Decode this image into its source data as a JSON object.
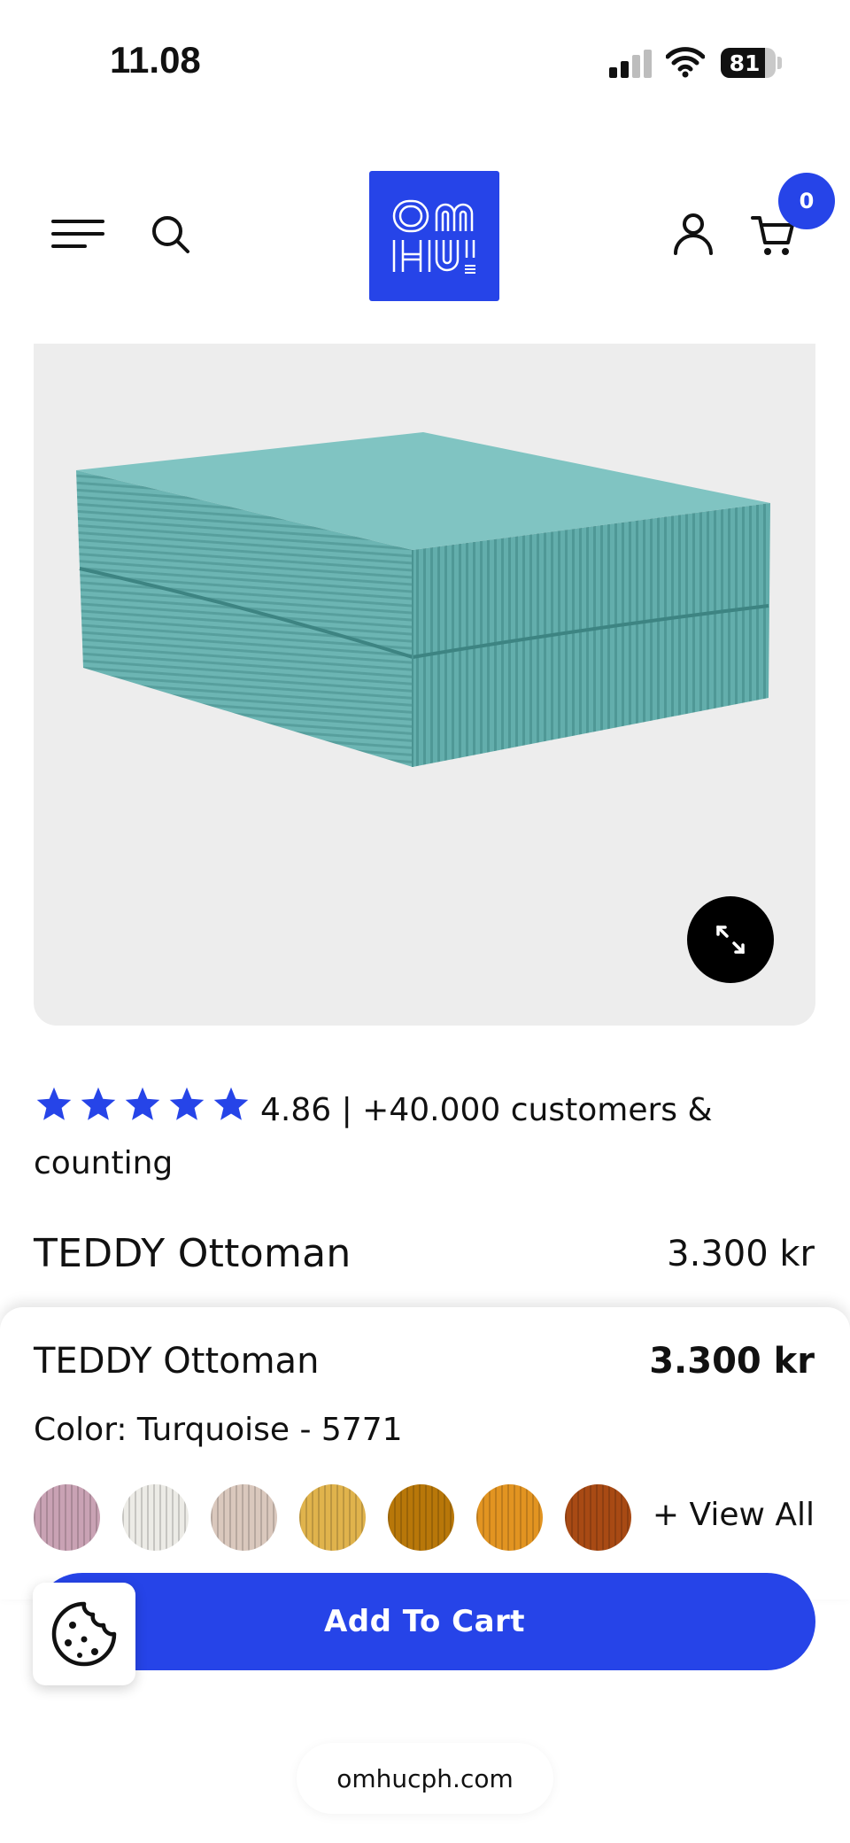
{
  "status_bar": {
    "time": "11.08",
    "battery": "81",
    "battery_level": 0.81
  },
  "header": {
    "logo_text": "OM HU",
    "cart_count": "0",
    "icons": [
      "hamburger-icon",
      "search-icon",
      "user-icon",
      "cart-icon"
    ]
  },
  "product_image": {
    "expand_icon": "expand-icon"
  },
  "rating": {
    "stars": 5,
    "text": "4.86 | +40.000 customers & counting"
  },
  "product": {
    "title": "TEDDY Ottoman",
    "price": "3.300 kr"
  },
  "sticky": {
    "title": "TEDDY Ottoman",
    "price": "3.300 kr",
    "color_label": "Color: Turquoise - 5771",
    "swatches": [
      "#c9a2b4",
      "#ecebe6",
      "#dac8bd",
      "#e0b34c",
      "#b87709",
      "#e29421",
      "#a84a14"
    ],
    "view_all": "+ View All",
    "add_to_cart": "Add To Cart"
  },
  "colors": {
    "accent": "#2644e8",
    "star": "#2644e8",
    "product_fabric": "#6fb8b6"
  },
  "browser": {
    "url": "omhucph.com"
  }
}
